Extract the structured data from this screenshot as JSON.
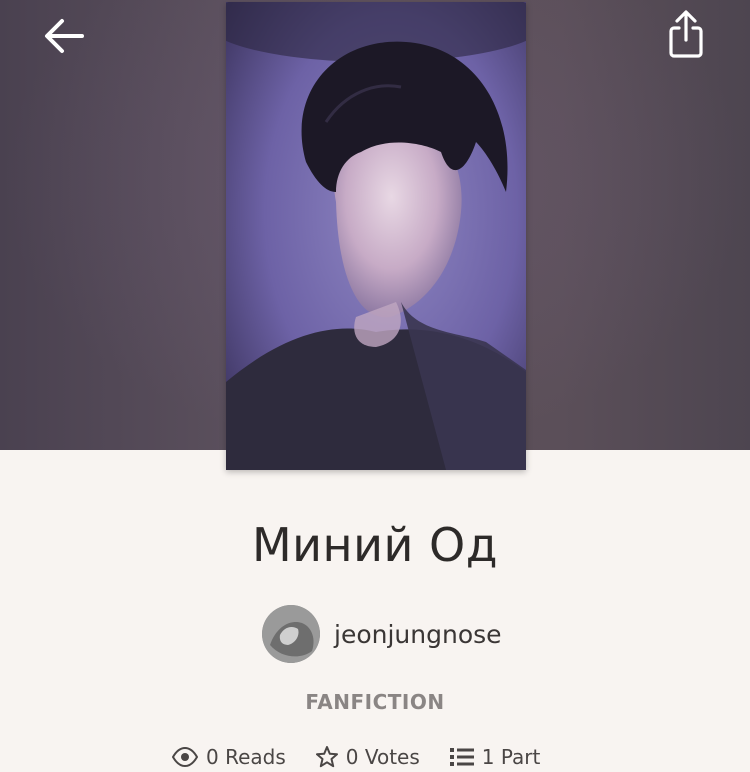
{
  "header": {
    "back_icon": "arrow-left-icon",
    "share_icon": "share-icon"
  },
  "story": {
    "title": "Миний Од",
    "author": "jeonjungnose",
    "category": "FANFICTION"
  },
  "stats": [
    {
      "icon": "eye-icon",
      "label": "0 Reads"
    },
    {
      "icon": "star-icon",
      "label": "0 Votes"
    },
    {
      "icon": "list-icon",
      "label": "1 Part"
    }
  ]
}
